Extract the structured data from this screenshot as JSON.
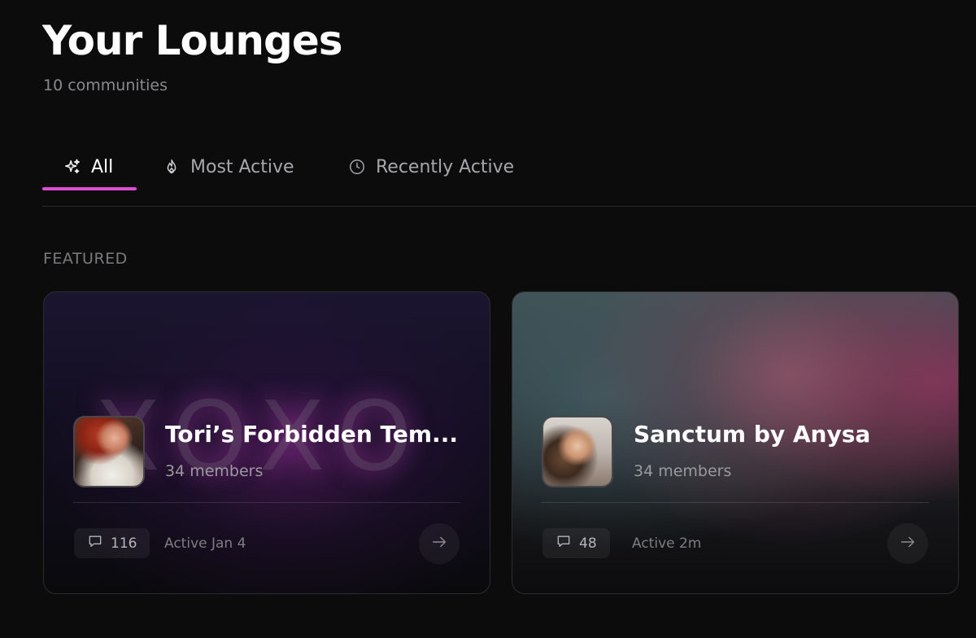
{
  "header": {
    "title": "Your Lounges",
    "subtitle": "10 communities"
  },
  "tabs": [
    {
      "label": "All",
      "icon": "sparkles-icon",
      "active": true
    },
    {
      "label": "Most Active",
      "icon": "fire-icon",
      "active": false
    },
    {
      "label": "Recently Active",
      "icon": "clock-icon",
      "active": false
    }
  ],
  "featured": {
    "label": "FEATURED",
    "cards": [
      {
        "name": "Tori’s Forbidden Tem...",
        "members": "34 members",
        "comments": "116",
        "active": "Active Jan 4",
        "banner_text": "XOXO"
      },
      {
        "name": "Sanctum by Anysa",
        "members": "34 members",
        "comments": "48",
        "active": "Active 2m"
      }
    ]
  },
  "colors": {
    "background": "#0c0c0d",
    "accent": "#e04bd3",
    "muted_text": "#8a8a8e"
  }
}
